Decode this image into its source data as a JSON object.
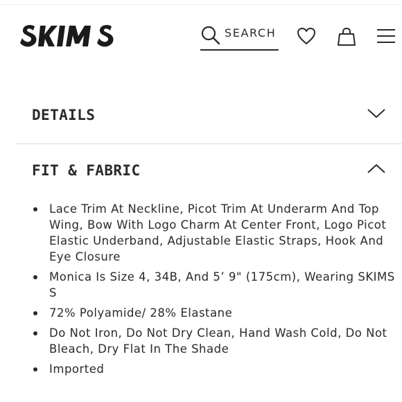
{
  "header": {
    "logo_text": "SKIMS",
    "search_label": "SEARCH",
    "icons": [
      "search-icon",
      "heart-icon",
      "bag-icon",
      "menu-icon"
    ]
  },
  "accordion": [
    {
      "title": "DETAILS",
      "state": "collapsed",
      "icon": "chevron-down-icon"
    },
    {
      "title": "FIT & FABRIC",
      "state": "expanded",
      "icon": "chevron-up-icon"
    }
  ],
  "fit_fabric": {
    "items": [
      "Lace Trim At Neckline, Picot Trim At Underarm And Top Wing, Bow With Logo Charm At Center Front, Logo Picot Elastic Underband, Adjustable Elastic Straps, Hook And Eye Closure",
      "Monica Is Size 4, 34B, And 5’ 9\" (175cm), Wearing SKIMS S",
      "72% Polyamide/ 28% Elastane",
      "Do Not Iron, Do Not Dry Clean, Hand Wash Cold, Do Not Bleach, Dry Flat In The Shade",
      "Imported"
    ]
  },
  "colors": {
    "text": "#2a2a2a",
    "divider": "#dcdcdc",
    "background": "#ffffff"
  }
}
